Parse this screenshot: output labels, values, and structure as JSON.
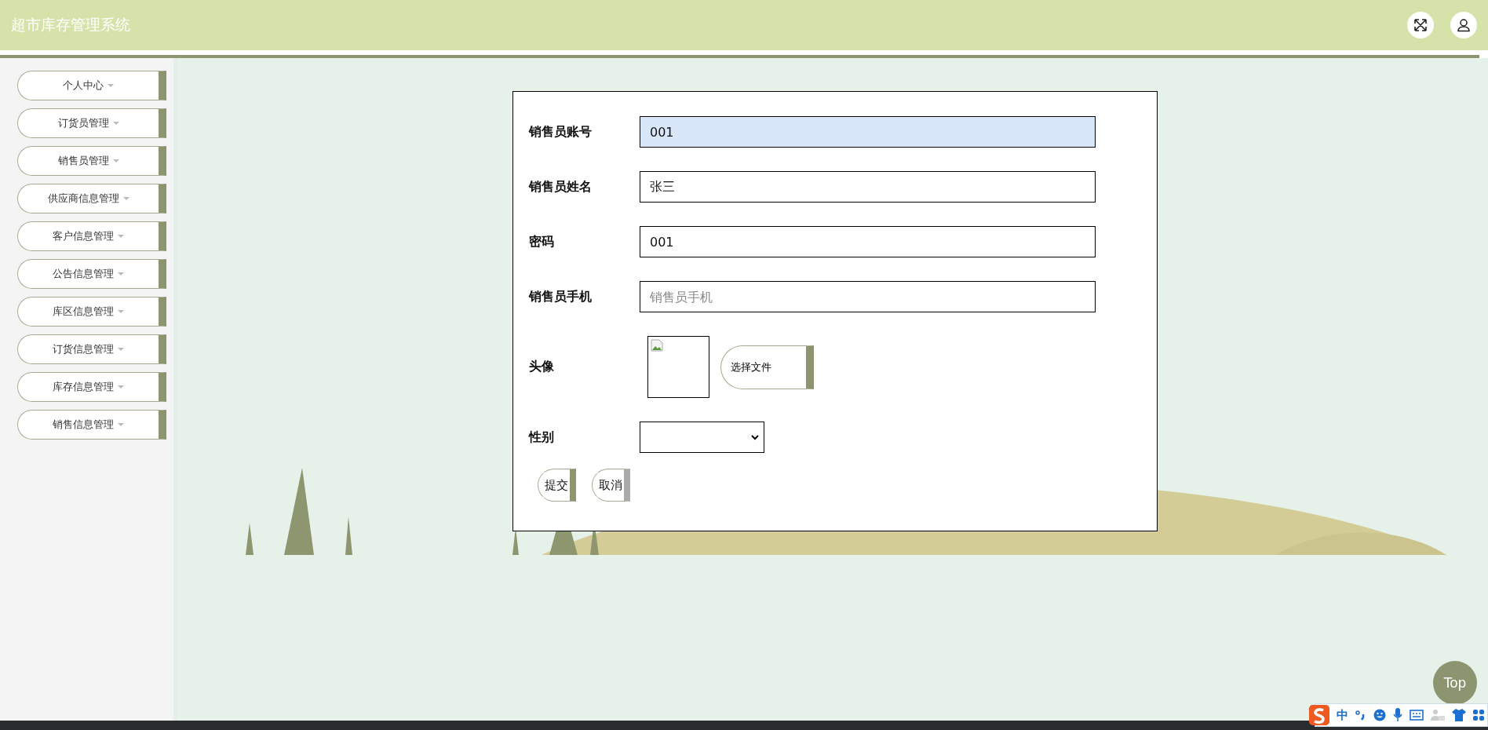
{
  "header": {
    "title": "超市库存管理系统"
  },
  "sidebar": {
    "items": [
      {
        "label": "个人中心"
      },
      {
        "label": "订货员管理"
      },
      {
        "label": "销售员管理"
      },
      {
        "label": "供应商信息管理"
      },
      {
        "label": "客户信息管理"
      },
      {
        "label": "公告信息管理"
      },
      {
        "label": "库区信息管理"
      },
      {
        "label": "订货信息管理"
      },
      {
        "label": "库存信息管理"
      },
      {
        "label": "销售信息管理"
      }
    ]
  },
  "form": {
    "fields": [
      {
        "kind": "input",
        "label": "销售员账号",
        "value": "001",
        "highlighted": true
      },
      {
        "kind": "input",
        "label": "销售员姓名",
        "value": "张三",
        "highlighted": false
      },
      {
        "kind": "input",
        "label": "密码",
        "value": "001",
        "highlighted": false
      },
      {
        "kind": "input",
        "label": "销售员手机",
        "placeholder": "销售员手机",
        "highlighted": false
      },
      {
        "kind": "image",
        "label": "头像",
        "button": "选择文件"
      },
      {
        "kind": "select",
        "label": "性别"
      }
    ],
    "buttons": [
      {
        "label": "提交",
        "color": "#8c9470"
      },
      {
        "label": "取消",
        "color": "#aaaaaa"
      }
    ]
  },
  "top_button": {
    "label": "Top"
  },
  "ime_bar": {
    "mode": "中"
  }
}
